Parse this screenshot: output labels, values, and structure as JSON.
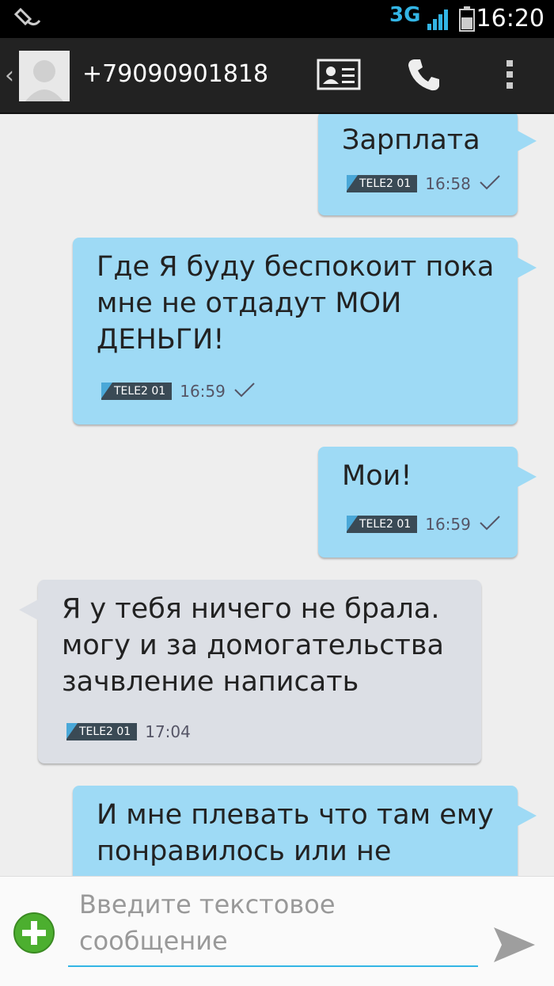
{
  "status_bar": {
    "network": "3G",
    "time": "16:20"
  },
  "action_bar": {
    "contact_number": "+79090901818"
  },
  "messages": [
    {
      "direction": "outgoing",
      "text": "Зарплата",
      "sim": "TELE2 01",
      "time": "16:58",
      "delivered": true
    },
    {
      "direction": "outgoing",
      "text": "Где Я буду беспокоит пока\nмне не отдадут МОИ\nДЕНЬГИ!",
      "sim": "TELE2 01",
      "time": "16:59",
      "delivered": true
    },
    {
      "direction": "outgoing",
      "text": "Мои!",
      "sim": "TELE2 01",
      "time": "16:59",
      "delivered": true
    },
    {
      "direction": "incoming",
      "text": "Я у тебя ничего не брала.\nмогу и за домогательства\nзачвление написать",
      "sim": "TELE2 01",
      "time": "17:04",
      "delivered": false
    },
    {
      "direction": "outgoing",
      "text": "И мне плевать что там ему\nпонравилось или не",
      "sim": "",
      "time": "",
      "delivered": false
    }
  ],
  "composer": {
    "placeholder": "Введите текстовое сообщение"
  },
  "colors": {
    "outgoing_bubble": "#9edaf5",
    "incoming_bubble": "#dcdfe5",
    "accent": "#33b5e5",
    "add_button": "#4caf2f"
  }
}
